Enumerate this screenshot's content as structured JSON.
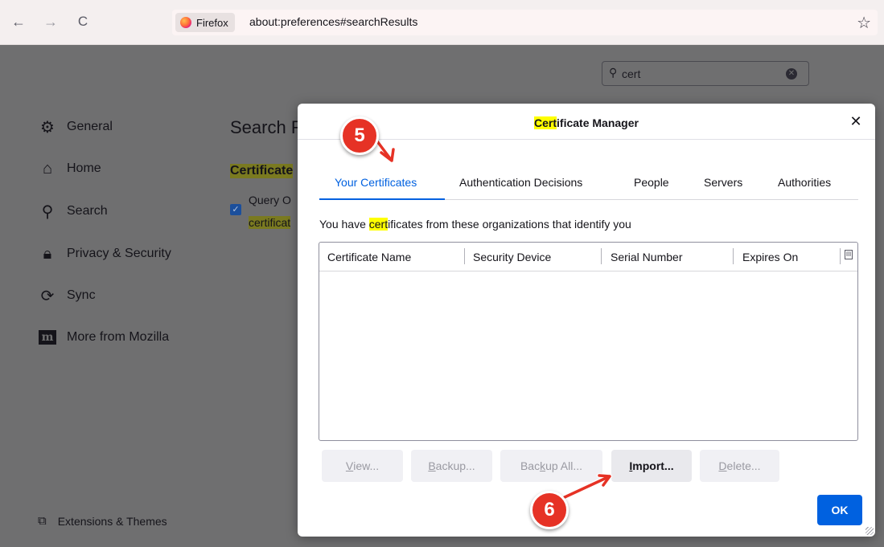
{
  "browser": {
    "identity_label": "Firefox",
    "url": "about:preferences#searchResults",
    "back_glyph": "←",
    "forward_glyph": "→",
    "reload_glyph": "C",
    "star_glyph": "☆"
  },
  "prefs": {
    "search_value": "cert",
    "categories": [
      {
        "label": "General",
        "icon": "gear-icon"
      },
      {
        "label": "Home",
        "icon": "home-icon"
      },
      {
        "label": "Search",
        "icon": "search-icon"
      },
      {
        "label": "Privacy & Security",
        "icon": "lock-icon"
      },
      {
        "label": "Sync",
        "icon": "sync-icon"
      },
      {
        "label": "More from Mozilla",
        "icon": "mozilla-m-icon"
      }
    ],
    "extensions_label": "Extensions & Themes",
    "results_title": "Search R",
    "cert_heading": "Certificate",
    "ocsp_line1": "Query O",
    "ocsp_line2": "certificat"
  },
  "dialog": {
    "title_highlight": "Cert",
    "title_rest": "ificate Manager",
    "tabs": [
      "Your Certificates",
      "Authentication Decisions",
      "People",
      "Servers",
      "Authorities"
    ],
    "active_tab": 0,
    "info_prefix": "You have ",
    "info_highlight": "cert",
    "info_suffix": "ificates from these organizations that identify you",
    "columns": [
      "Certificate Name",
      "Security Device",
      "Serial Number",
      "Expires On"
    ],
    "buttons": {
      "view": {
        "pre": "",
        "u": "V",
        "post": "iew...",
        "enabled": false
      },
      "backup": {
        "pre": "",
        "u": "B",
        "post": "ackup...",
        "enabled": false
      },
      "backup_all": {
        "pre": "Bac",
        "u": "k",
        "post": "up All...",
        "enabled": false
      },
      "import": {
        "pre": "",
        "u": "I",
        "post": "mport...",
        "enabled": true
      },
      "delete": {
        "pre": "",
        "u": "D",
        "post": "elete...",
        "enabled": false
      }
    },
    "ok_label": "OK",
    "close_glyph": "✕"
  },
  "annotations": {
    "step5": "5",
    "step6": "6",
    "color": "#e63225"
  }
}
